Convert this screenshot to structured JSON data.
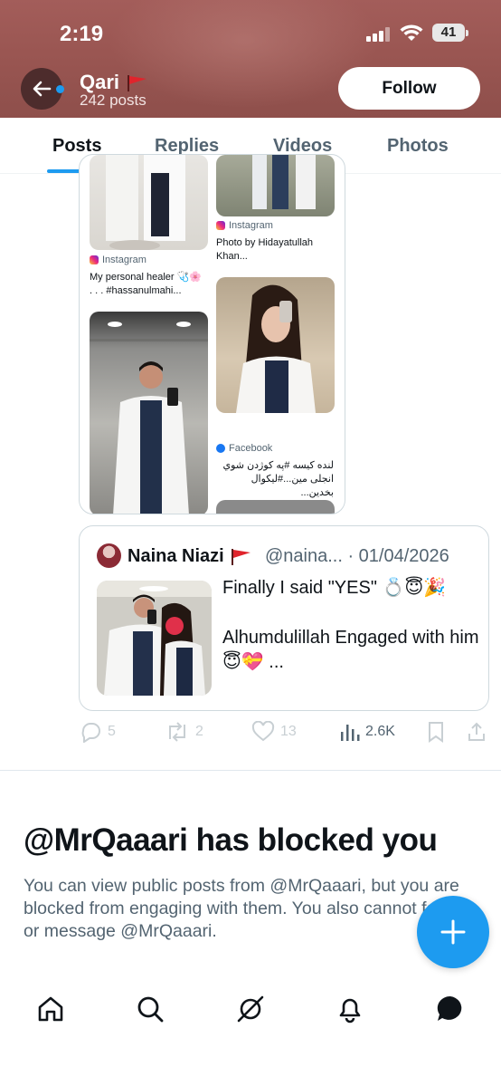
{
  "status_bar": {
    "time": "2:19",
    "battery": "41"
  },
  "profile": {
    "name": "Qari",
    "post_count": "242 posts",
    "follow_label": "Follow"
  },
  "tabs": [
    {
      "label": "Posts",
      "active": true
    },
    {
      "label": "Replies",
      "active": false
    },
    {
      "label": "Videos",
      "active": false
    },
    {
      "label": "Photos",
      "active": false
    }
  ],
  "media_grid": {
    "items": [
      {
        "source": "Instagram",
        "caption": "My personal healer 🩺🌸 . . . #hassanulmahi..."
      },
      {
        "source": "Instagram",
        "caption": "Photo by Hidayatullah Khan..."
      },
      {
        "source": "Facebook",
        "caption": "لنده کیسه #په کوژدن شوي انجلی مین...#لیکوال بخدین..."
      }
    ]
  },
  "quoted_post": {
    "author_name": "Naina Niazi",
    "handle_date": "@naina... · 01/04/2026",
    "text_line1": "Finally I said \"YES\" 💍😇🎉",
    "text_line2": "Alhumdulillah Engaged with him😇💝 ..."
  },
  "actions": {
    "replies": "5",
    "reposts": "2",
    "likes": "13",
    "views": "2.6K"
  },
  "blocked": {
    "title": "@MrQaaari has blocked you",
    "body": "You can view public posts from @MrQaaari, but you are blocked from engaging with them. You also cannot follow or message @MrQaaari."
  },
  "colors": {
    "accent": "#1d9bf0",
    "header_bg": "#9a5652",
    "text_secondary": "#536471"
  }
}
